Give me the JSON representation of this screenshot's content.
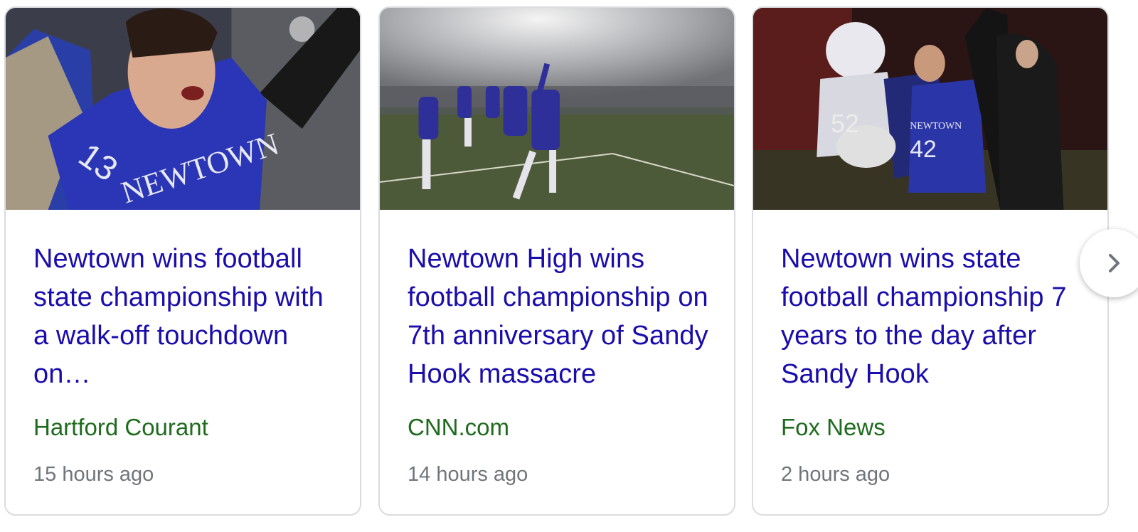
{
  "cards": [
    {
      "headline": "Newtown wins football state championship with a walk-off touchdown on…",
      "source": "Hartford Courant",
      "time": "15 hours ago"
    },
    {
      "headline": "Newtown High wins football championship on 7th anniversary of Sandy Hook massacre",
      "source": "CNN.com",
      "time": "14 hours ago"
    },
    {
      "headline": "Newtown wins state football championship 7 years to the day after Sandy Hook",
      "source": "Fox News",
      "time": "2 hours ago"
    }
  ],
  "carousel": {
    "next_icon": "chevron-right-icon"
  },
  "colors": {
    "headline": "#1a0dab",
    "source": "#1e6b1e",
    "time": "#70757a",
    "border": "#dadce0"
  }
}
